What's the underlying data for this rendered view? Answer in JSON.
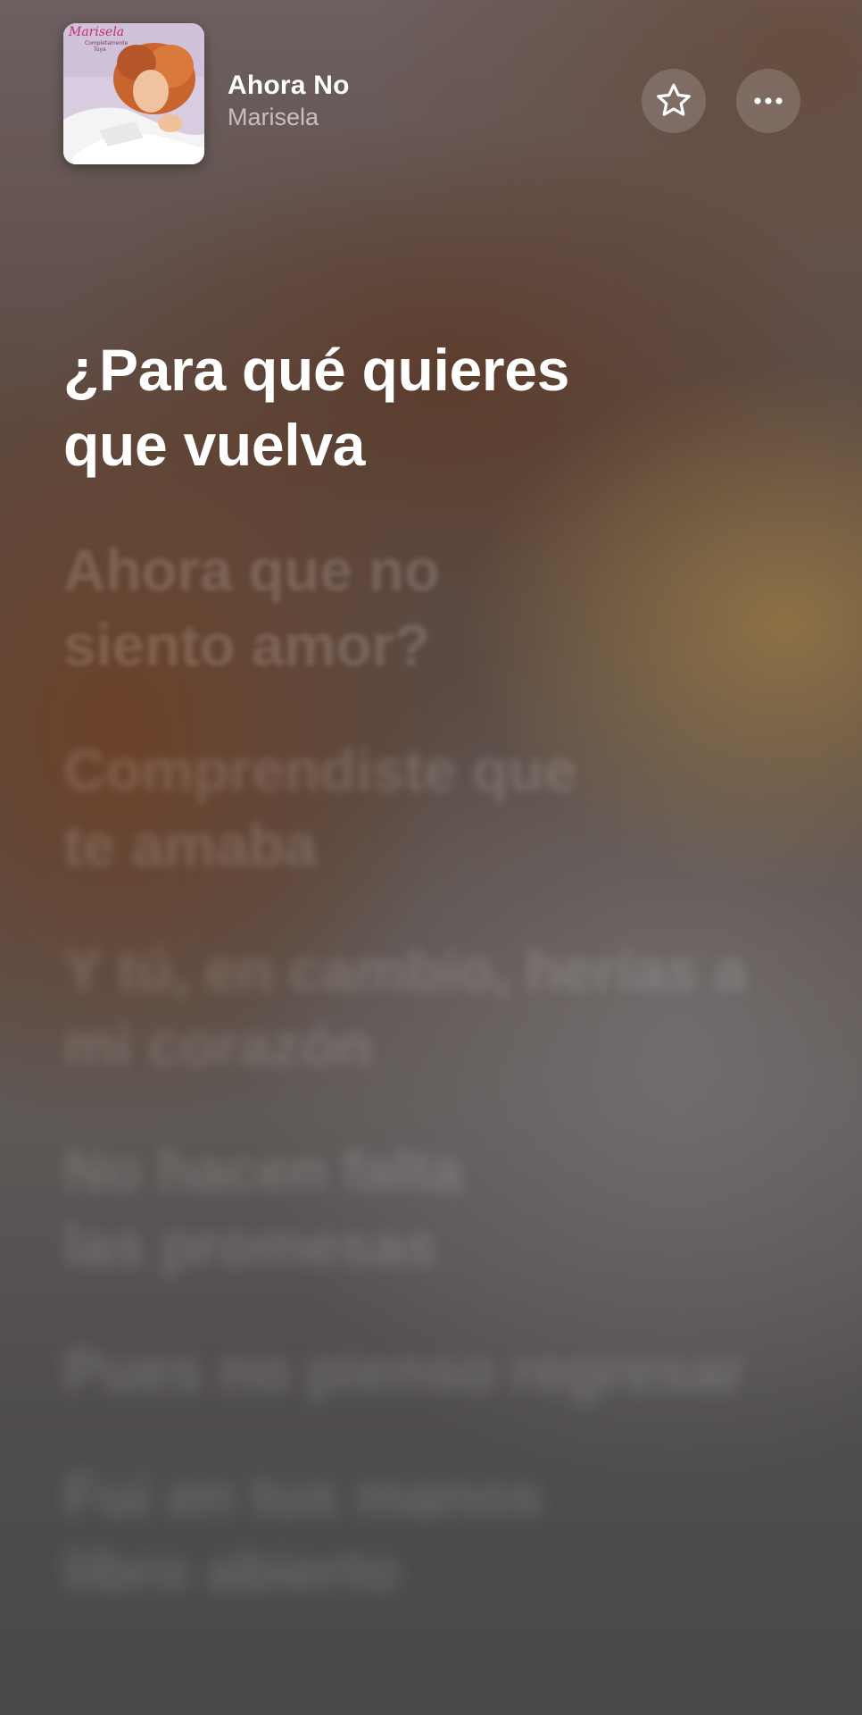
{
  "now_playing": {
    "title": "Ahora No",
    "artist": "Marisela",
    "album_cover_text": "Marisela"
  },
  "buttons": {
    "favorite_icon": "star-icon",
    "more_icon": "ellipsis-icon"
  },
  "lyrics": {
    "current": "¿Para qué quieres que vuelva",
    "upcoming": [
      "Ahora que no siento amor?",
      "Comprendiste que te amaba",
      "Y tú, en cambio, herías a mi corazón",
      "No hacen falta las promesas",
      "Pues no pienso regresar",
      "Fui en tus manos libro abierto"
    ]
  },
  "colors": {
    "text_active": "#ffffff",
    "button_bg": "rgba(255,255,255,0.16)"
  }
}
